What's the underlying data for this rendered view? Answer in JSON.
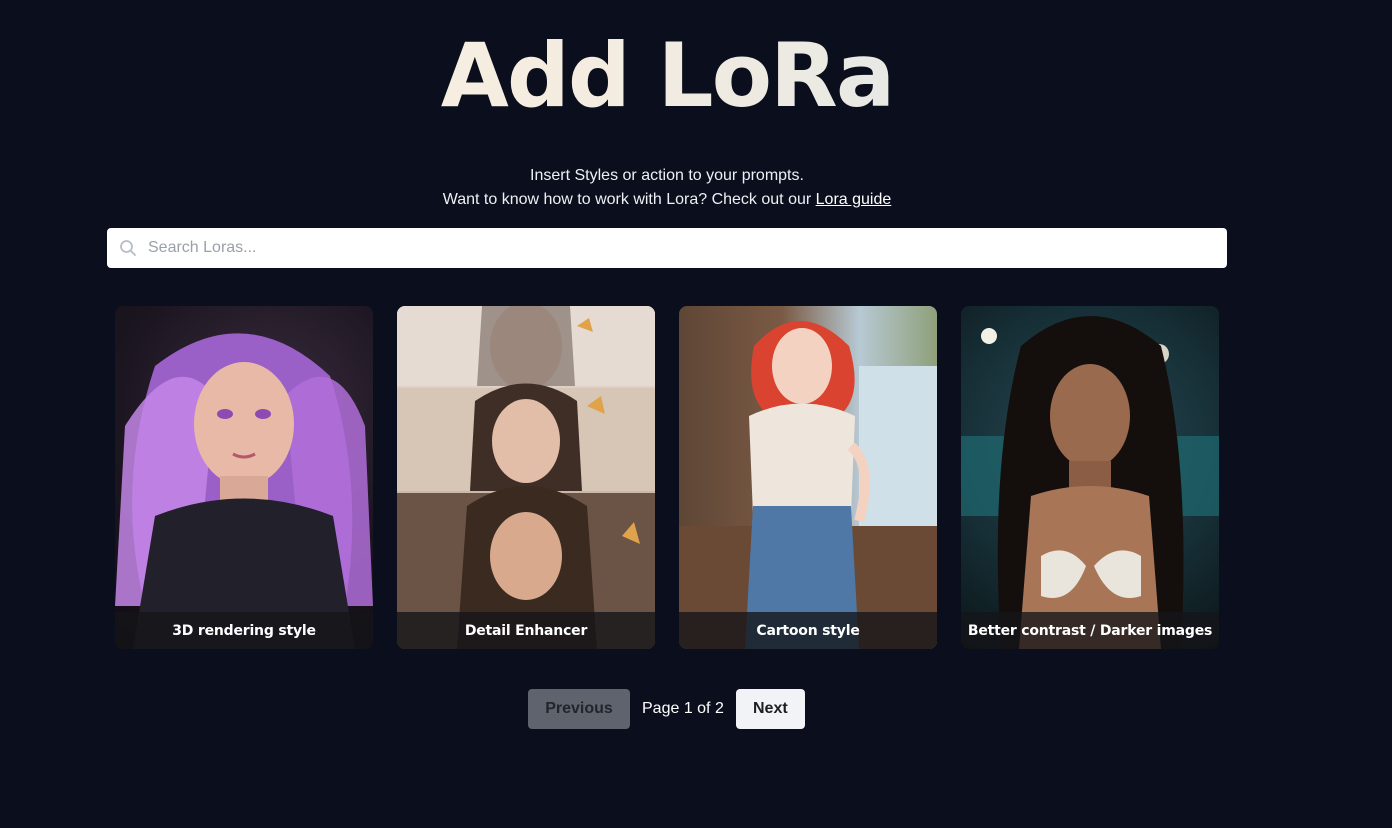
{
  "header": {
    "title": "Add LoRa",
    "line1": "Insert Styles or action to your prompts.",
    "line2_prefix": "Want to know how to work with Lora? Check out our ",
    "guide_link": "Lora guide"
  },
  "search": {
    "placeholder": "Search Loras...",
    "value": "",
    "icon": "search-icon"
  },
  "cards": [
    {
      "label": "3D rendering style",
      "accent": "#b57ad6"
    },
    {
      "label": "Detail Enhancer",
      "accent": "#c9a06a"
    },
    {
      "label": "Cartoon style",
      "accent": "#d9483a"
    },
    {
      "label": "Better contrast / Darker images",
      "accent": "#3c8c93"
    }
  ],
  "pagination": {
    "previous_label": "Previous",
    "page_info": "Page 1 of 2",
    "next_label": "Next"
  },
  "colors": {
    "background": "#0b0e1c",
    "button_disabled": "#5f636e",
    "button_active": "#f1f3f6"
  }
}
